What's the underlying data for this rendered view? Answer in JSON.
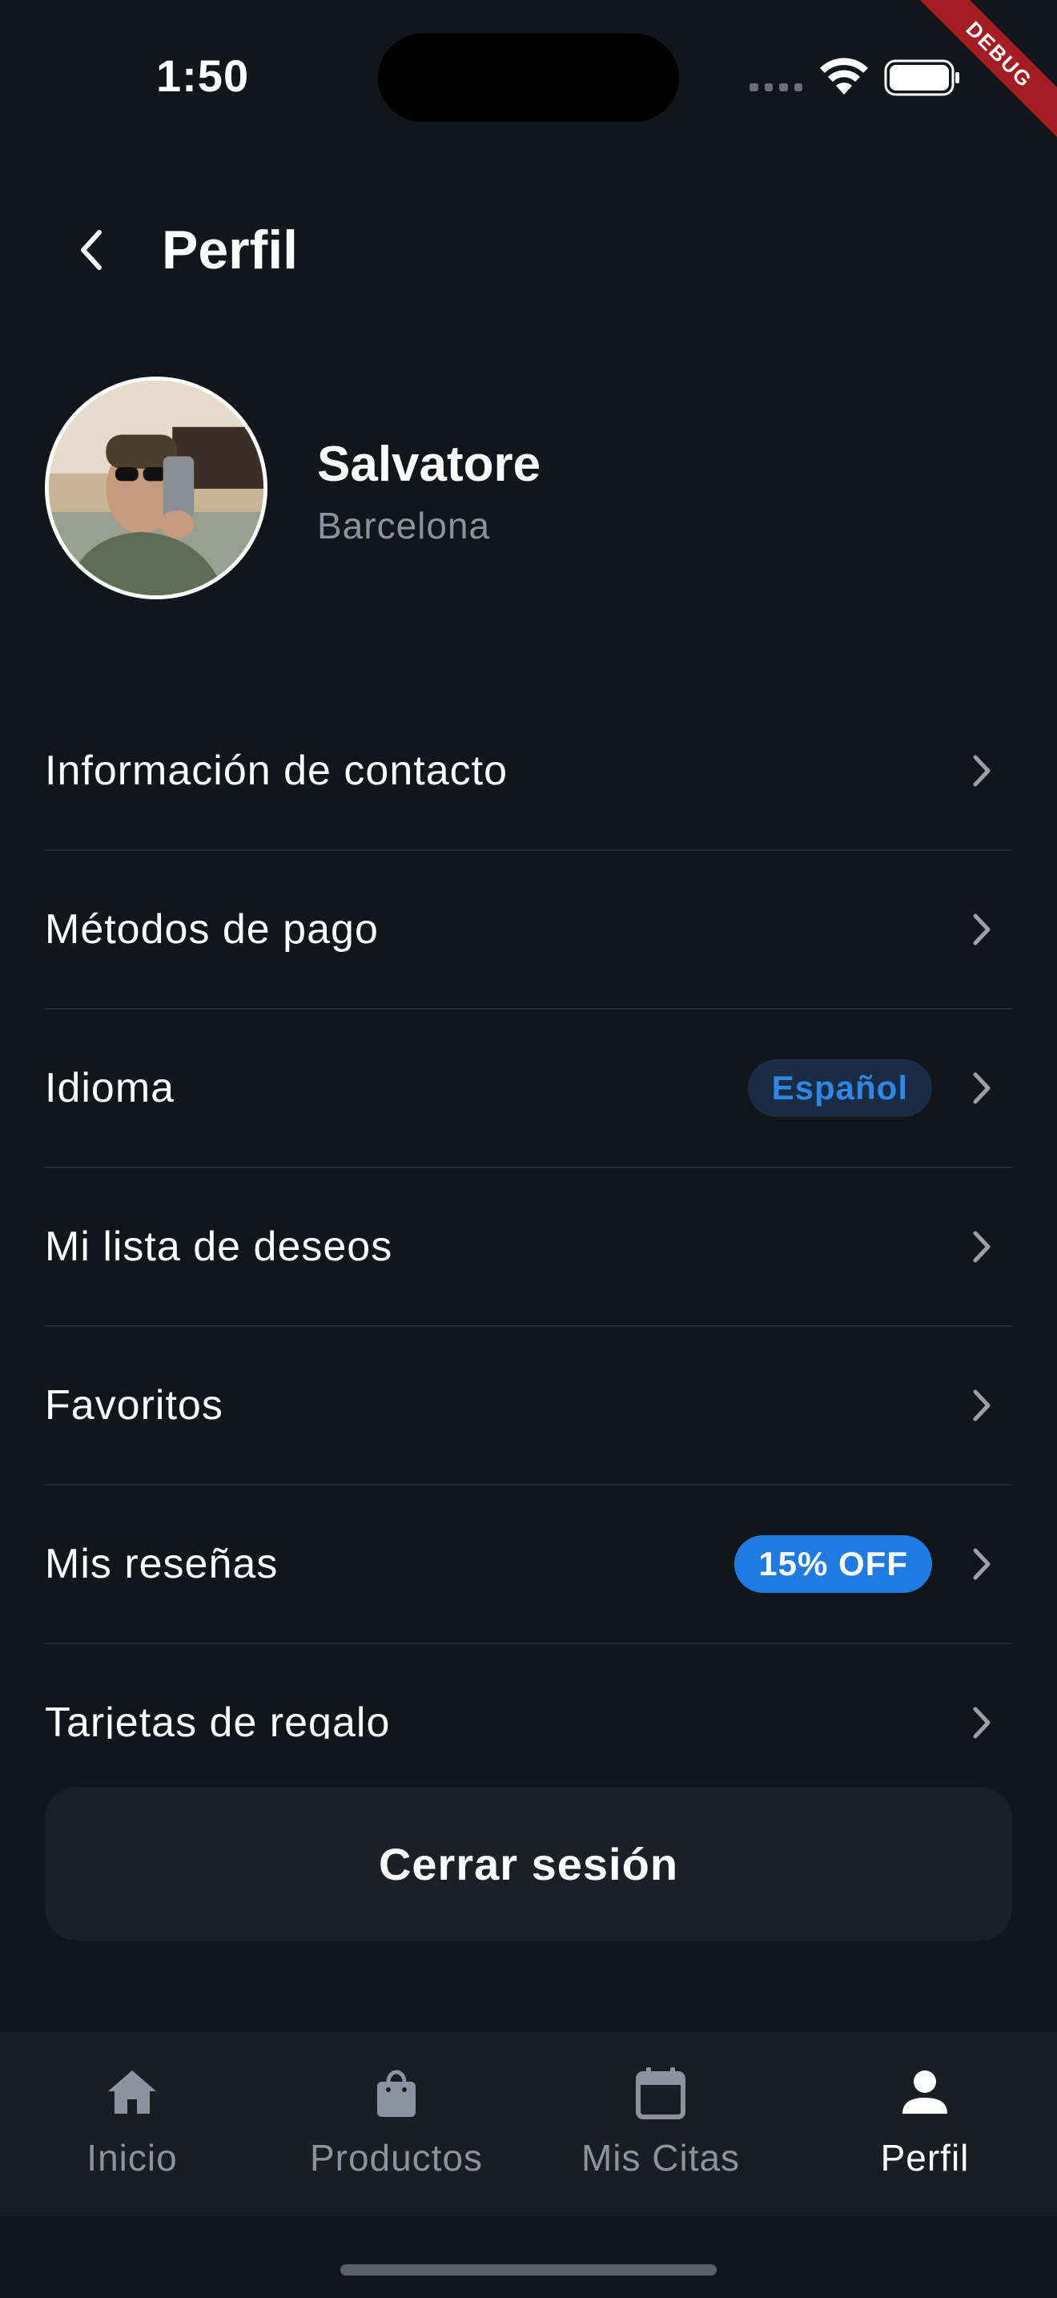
{
  "status_bar": {
    "time": "1:50",
    "debug_label": "DEBUG"
  },
  "header": {
    "title": "Perfil",
    "back_icon": "chevron-left-icon"
  },
  "profile": {
    "name": "Salvatore",
    "city": "Barcelona"
  },
  "menu": {
    "items": [
      {
        "label": "Información de contacto"
      },
      {
        "label": "Métodos de pago"
      },
      {
        "label": "Idioma",
        "badge": "Español"
      },
      {
        "label": "Mi lista de deseos"
      },
      {
        "label": "Favoritos"
      },
      {
        "label": "Mis reseñas",
        "badge": "15% OFF"
      },
      {
        "label": "Tarjetas de regalo"
      }
    ]
  },
  "logout": {
    "label": "Cerrar sesión"
  },
  "bottom_nav": {
    "items": [
      {
        "label": "Inicio",
        "icon": "home-icon"
      },
      {
        "label": "Productos",
        "icon": "shopping-bag-icon"
      },
      {
        "label": "Mis Citas",
        "icon": "calendar-icon"
      },
      {
        "label": "Perfil",
        "icon": "person-icon",
        "active": true
      }
    ]
  },
  "colors": {
    "background": "#12151a",
    "surface": "#1c1f24",
    "accent_blue": "#1f7be0",
    "muted_text": "#8c93a0",
    "debug_ribbon": "#a31c21"
  }
}
